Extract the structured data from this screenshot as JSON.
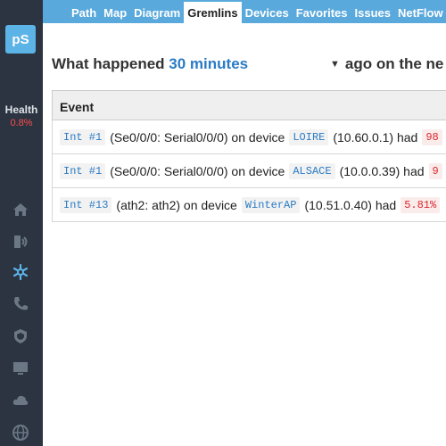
{
  "sidebar": {
    "logo": "pS",
    "health_label": "Health",
    "health_value": "0.8%",
    "icons": [
      "home-icon",
      "signal-icon",
      "gremlins-icon",
      "phone-icon",
      "shield-icon",
      "monitor-icon",
      "cloud-icon",
      "globe-icon"
    ]
  },
  "topmenu": {
    "tabs": [
      "Path",
      "Map",
      "Diagram",
      "Gremlins",
      "Devices",
      "Favorites",
      "Issues",
      "NetFlow"
    ],
    "active": "Gremlins"
  },
  "headline": {
    "prefix": "What happened",
    "duration": "30 minutes",
    "suffix": "ago on the ne"
  },
  "table": {
    "header": "Event",
    "rows": [
      {
        "int": "Int #1",
        "iface": "(Se0/0/0: Serial0/0/0) on device",
        "device": "LOIRE",
        "ip": "(10.60.0.1) had",
        "value": "98"
      },
      {
        "int": "Int #1",
        "iface": "(Se0/0/0: Serial0/0/0) on device",
        "device": "ALSACE",
        "ip": "(10.0.0.39) had",
        "value": "9"
      },
      {
        "int": "Int #13",
        "iface": "(ath2: ath2) on device",
        "device": "WinterAP",
        "ip": "(10.51.0.40) had",
        "value": "5.81%"
      }
    ]
  },
  "colors": {
    "sidebar": "#2b3440",
    "topmenu": "#5aa9dc",
    "accent": "#2a7bc4",
    "alert": "#d9262c"
  }
}
